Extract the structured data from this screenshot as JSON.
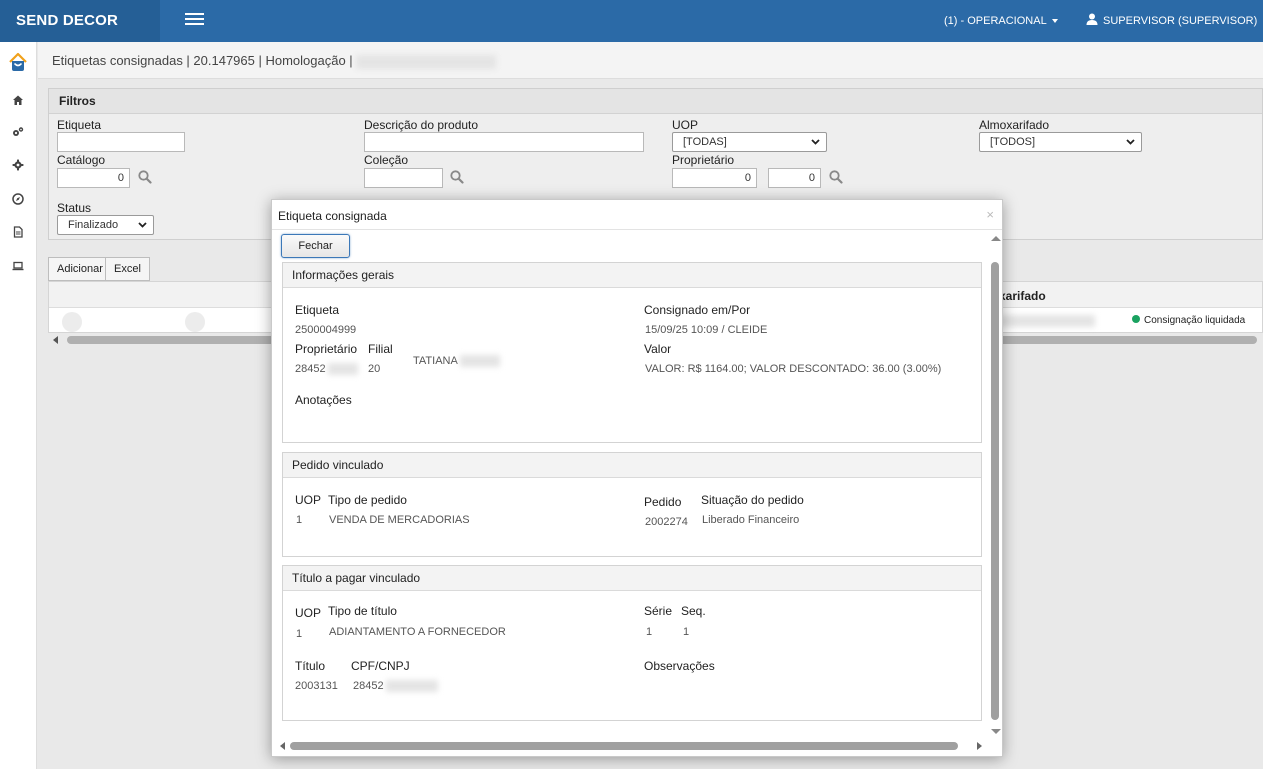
{
  "app": {
    "brand": "SEND DECOR"
  },
  "header": {
    "context": "(1) - OPERACIONAL",
    "user": "SUPERVISOR (SUPERVISOR)"
  },
  "sidebar": {
    "icons": [
      "home-icon",
      "cogs-icon",
      "gear-icon",
      "compass-icon",
      "document-icon",
      "laptop-icon"
    ]
  },
  "breadcrumb": {
    "text": "Etiquetas consignadas | 20.147965 | Homologação |"
  },
  "filters": {
    "title": "Filtros",
    "etiqueta_label": "Etiqueta",
    "etiqueta_value": "",
    "descricao_label": "Descrição do produto",
    "descricao_value": "",
    "uop_label": "UOP",
    "uop_value": "[TODAS]",
    "almox_label": "Almoxarifado",
    "almox_value": "[TODOS]",
    "catalogo_label": "Catálogo",
    "catalogo_value": "0",
    "colecao_label": "Coleção",
    "colecao_value": "",
    "proprietario_label": "Proprietário",
    "proprietario_value1": "0",
    "proprietario_value2": "0",
    "status_label": "Status",
    "status_value": "Finalizado"
  },
  "toolbar": {
    "adicionar": "Adicionar",
    "excel": "Excel"
  },
  "grid": {
    "header_almox": "xarifado",
    "row_status": "Consignação liquidada",
    "status_color": "#1aa260"
  },
  "modal": {
    "title": "Etiqueta consignada",
    "close": "×",
    "fechar": "Fechar",
    "info": {
      "title": "Informações gerais",
      "etiqueta_label": "Etiqueta",
      "etiqueta_value": "2500004999",
      "consignado_label": "Consignado em/Por",
      "consignado_value": "15/09/25 10:09 / CLEIDE",
      "proprietario_label": "Proprietário",
      "proprietario_value": "28452",
      "filial_label": "Filial",
      "filial_value": "20",
      "nome_value": "TATIANA",
      "valor_label": "Valor",
      "valor_value": "VALOR: R$ 1164.00; VALOR DESCONTADO: 36.00 (3.00%)",
      "anotacoes_label": "Anotações"
    },
    "pedido": {
      "title": "Pedido vinculado",
      "uop_label": "UOP",
      "uop_value": "1",
      "tipo_label": "Tipo de pedido",
      "tipo_value": "VENDA DE MERCADORIAS",
      "pedido_label": "Pedido",
      "pedido_value": "2002274",
      "situacao_label": "Situação do pedido",
      "situacao_value": "Liberado Financeiro"
    },
    "titulo": {
      "title": "Título a pagar vinculado",
      "uop_label": "UOP",
      "uop_value": "1",
      "tipo_label": "Tipo de título",
      "tipo_value": "ADIANTAMENTO A FORNECEDOR",
      "serie_label": "Série",
      "serie_value": "1",
      "seq_label": "Seq.",
      "seq_value": "1",
      "titulo_label": "Título",
      "titulo_value": "2003131",
      "cpf_label": "CPF/CNPJ",
      "cpf_value": "28452",
      "obs_label": "Observações"
    }
  },
  "colors": {
    "topbar": "#2b6aa7",
    "brand_bg": "#255f96",
    "accent": "#3b78b8"
  }
}
